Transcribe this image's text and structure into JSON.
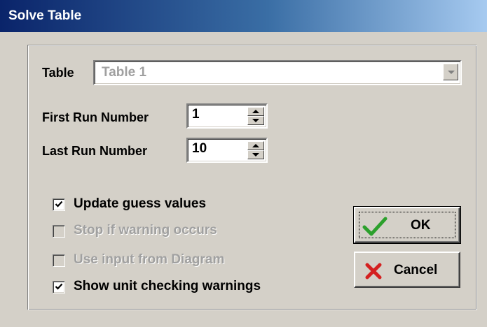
{
  "window": {
    "title": "Solve Table"
  },
  "table": {
    "label": "Table",
    "value": "Table 1"
  },
  "first_run": {
    "label": "First Run Number",
    "value": "1"
  },
  "last_run": {
    "label": "Last Run Number",
    "value": "10"
  },
  "options": [
    {
      "label": "Update guess values",
      "checked": true,
      "enabled": true
    },
    {
      "label": "Stop if warning occurs",
      "checked": false,
      "enabled": false
    },
    {
      "label": "Use input from Diagram",
      "checked": false,
      "enabled": false
    },
    {
      "label": "Show unit checking warnings",
      "checked": true,
      "enabled": true
    }
  ],
  "buttons": {
    "ok_label": "OK",
    "ok_icon": "checkmark-icon",
    "cancel_label": "Cancel",
    "cancel_icon": "red-x-icon"
  },
  "colors": {
    "title_gradient_start": "#0a246a",
    "title_gradient_end": "#a6caf0",
    "dialog_background": "#d4d0c8",
    "ok_check": "#2ca02c",
    "cancel_x": "#d42020"
  }
}
